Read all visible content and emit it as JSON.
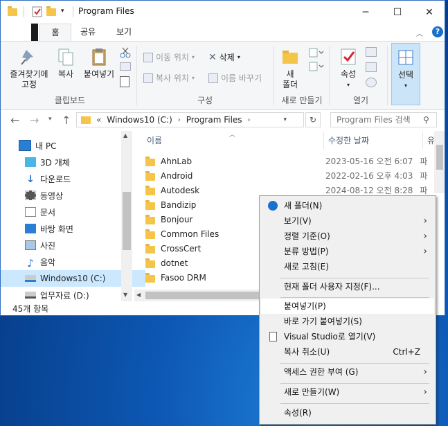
{
  "window": {
    "title": "Program Files",
    "min": "─",
    "max": "☐",
    "close": "✕"
  },
  "ribbon_tabs": [
    "홈",
    "공유",
    "보기"
  ],
  "ribbon": {
    "pin_label_1": "즐겨찾기에",
    "pin_label_2": "고정",
    "copy": "복사",
    "paste": "붙여넣기",
    "group_clipboard": "클립보드",
    "move_to": "이동 위치",
    "copy_to": "복사 위치",
    "delete": "삭제",
    "rename": "이름 바꾸기",
    "group_organize": "구성",
    "new_folder_1": "새",
    "new_folder_2": "폴더",
    "group_new": "새로 만들기",
    "properties": "속성",
    "group_open": "열기",
    "select": "선택"
  },
  "address": {
    "prefix": "«",
    "crumbs": [
      "Windows10 (C:)",
      "Program Files"
    ],
    "search_placeholder": "Program Files 검색"
  },
  "nav_pane": {
    "items": [
      {
        "label": "내 PC",
        "icon": "pc-icon"
      },
      {
        "label": "3D 개체",
        "icon": "cube-icon"
      },
      {
        "label": "다운로드",
        "icon": "download-icon"
      },
      {
        "label": "동영상",
        "icon": "video-icon"
      },
      {
        "label": "문서",
        "icon": "document-icon"
      },
      {
        "label": "바탕 화면",
        "icon": "desktop-icon"
      },
      {
        "label": "사진",
        "icon": "picture-icon"
      },
      {
        "label": "음악",
        "icon": "music-icon"
      },
      {
        "label": "Windows10 (C:)",
        "icon": "drive-icon"
      },
      {
        "label": "업무자료 (D:)",
        "icon": "drive-icon"
      }
    ]
  },
  "columns": {
    "name": "이름",
    "date": "수정한 날짜",
    "type": "유"
  },
  "files": [
    {
      "name": "AhnLab",
      "date": "2023-05-16 오전 6:07",
      "type": "파"
    },
    {
      "name": "Android",
      "date": "2022-02-16 오후 4:03",
      "type": "파"
    },
    {
      "name": "Autodesk",
      "date": "2024-08-12 오전 8:28",
      "type": "파"
    },
    {
      "name": "Bandizip",
      "date": "",
      "type": ""
    },
    {
      "name": "Bonjour",
      "date": "",
      "type": ""
    },
    {
      "name": "Common Files",
      "date": "",
      "type": ""
    },
    {
      "name": "CrossCert",
      "date": "",
      "type": ""
    },
    {
      "name": "dotnet",
      "date": "",
      "type": ""
    },
    {
      "name": "Fasoo DRM",
      "date": "",
      "type": ""
    }
  ],
  "status": {
    "count": "45개 항목"
  },
  "context_menu": {
    "items": [
      {
        "label": "새 폴더(N)",
        "shortcut": "",
        "submenu": false
      },
      {
        "label": "보기(V)",
        "shortcut": "",
        "submenu": true
      },
      {
        "label": "정렬 기준(O)",
        "shortcut": "",
        "submenu": true
      },
      {
        "label": "분류 방법(P)",
        "shortcut": "",
        "submenu": true
      },
      {
        "label": "새로 고침(E)",
        "shortcut": "",
        "submenu": false
      },
      {
        "label": "현재 폴더 사용자 지정(F)...",
        "shortcut": "",
        "submenu": false
      },
      {
        "label": "붙여넣기(P)",
        "shortcut": "",
        "submenu": false
      },
      {
        "label": "바로 가기 붙여넣기(S)",
        "shortcut": "",
        "submenu": false
      },
      {
        "label": "Visual Studio로 열기(V)",
        "shortcut": "",
        "submenu": false
      },
      {
        "label": "복사 취소(U)",
        "shortcut": "Ctrl+Z",
        "submenu": false
      },
      {
        "label": "액세스 권한 부여 (G)",
        "shortcut": "",
        "submenu": true
      },
      {
        "label": "새로 만들기(W)",
        "shortcut": "",
        "submenu": true
      },
      {
        "label": "속성(R)",
        "shortcut": "",
        "submenu": false
      }
    ]
  },
  "colors": {
    "accent": "#0078d7",
    "selection": "#cce8ff",
    "folder": "#f5c54a"
  }
}
